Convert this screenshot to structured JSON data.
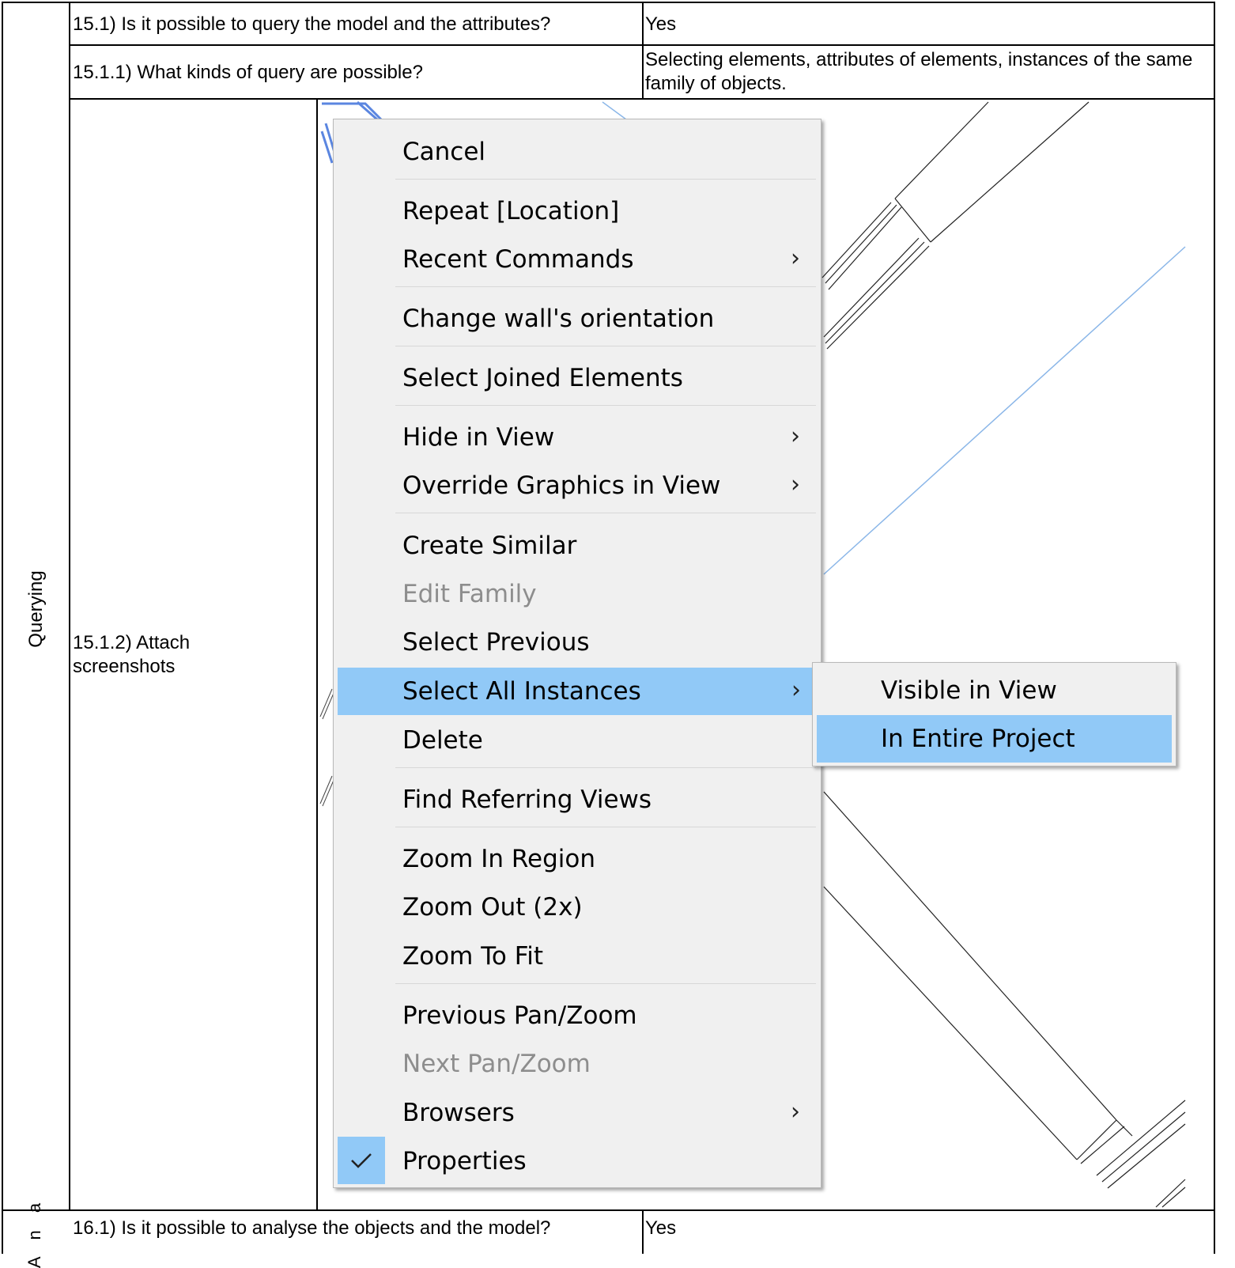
{
  "section": {
    "querying_label": "Querying",
    "analysis_label_partial": "A n a"
  },
  "rows": [
    {
      "question": "15.1) Is it possible to query the model and the attributes?",
      "answer": "Yes"
    },
    {
      "question": "15.1.1) What kinds of query are possible?",
      "answer": "Selecting elements, attributes of elements, instances of the same family of objects."
    },
    {
      "question": "15.1.2) Attach screenshots"
    },
    {
      "question": "16.1) Is it possible to analyse the objects and the model?",
      "answer": "Yes"
    }
  ],
  "context_menu": {
    "items": [
      {
        "label": "Cancel"
      },
      {
        "label": "Repeat [Location]"
      },
      {
        "label": "Recent Commands",
        "submenu": true
      },
      {
        "label": "Change wall's orientation"
      },
      {
        "label": "Select Joined Elements"
      },
      {
        "label": "Hide in View",
        "submenu": true
      },
      {
        "label": "Override Graphics in View",
        "submenu": true
      },
      {
        "label": "Create Similar"
      },
      {
        "label": "Edit Family",
        "disabled": true
      },
      {
        "label": "Select Previous"
      },
      {
        "label": "Select All Instances",
        "submenu": true,
        "highlighted": true
      },
      {
        "label": "Delete"
      },
      {
        "label": "Find Referring Views"
      },
      {
        "label": "Zoom In Region"
      },
      {
        "label": "Zoom Out (2x)"
      },
      {
        "label": "Zoom To Fit"
      },
      {
        "label": "Previous Pan/Zoom"
      },
      {
        "label": "Next Pan/Zoom",
        "disabled": true
      },
      {
        "label": "Browsers",
        "submenu": true
      },
      {
        "label": "Properties",
        "checked": true
      }
    ],
    "chevron": "›",
    "check_icon": "check-icon"
  },
  "submenu": {
    "items": [
      {
        "label": "Visible in View"
      },
      {
        "label": "In Entire Project",
        "highlighted": true
      }
    ]
  },
  "colors": {
    "highlight": "#91c9f7",
    "menu_bg": "#f0f0f0",
    "disabled_text": "#8d8d8d",
    "drawing_line_blue": "#8ab6e8"
  }
}
